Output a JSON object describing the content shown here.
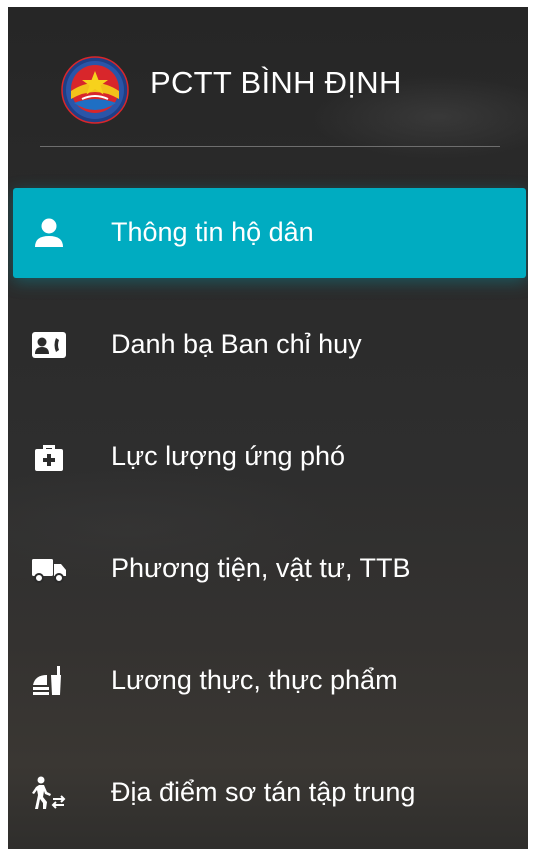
{
  "brand": {
    "title": "PCTT BÌNH ĐỊNH",
    "logo_icon": "pctt-emblem-icon"
  },
  "colors": {
    "active_item": "#00acc1",
    "sidebar_bg": "#2b2b2b",
    "text": "#ffffff",
    "divider": "#6e6e6e"
  },
  "menu": {
    "items": [
      {
        "label": "Thông tin hộ dân",
        "icon": "person-icon",
        "active": true
      },
      {
        "label": "Danh bạ Ban chỉ huy",
        "icon": "contact-card-icon",
        "active": false
      },
      {
        "label": "Lực lượng ứng phó",
        "icon": "medical-kit-icon",
        "active": false
      },
      {
        "label": "Phương tiện, vật tư, TTB",
        "icon": "truck-icon",
        "active": false
      },
      {
        "label": "Lương thực, thực phẩm",
        "icon": "food-icon",
        "active": false
      },
      {
        "label": "Địa điểm sơ tán tập trung",
        "icon": "evacuation-icon",
        "active": false
      }
    ]
  }
}
